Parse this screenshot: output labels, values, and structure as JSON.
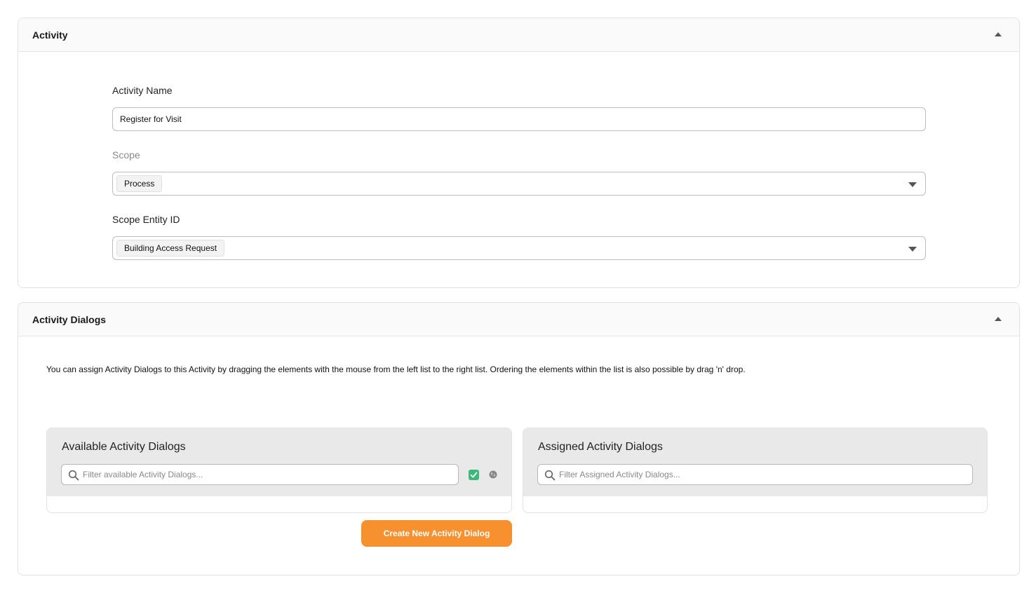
{
  "activity_section": {
    "title": "Activity",
    "fields": {
      "activity_name": {
        "label": "Activity Name",
        "value": "Register for Visit"
      },
      "scope": {
        "label": "Scope",
        "value": "Process"
      },
      "scope_entity_id": {
        "label": "Scope Entity ID",
        "value": "Building Access Request"
      }
    }
  },
  "dialogs_section": {
    "title": "Activity Dialogs",
    "info": "You can assign Activity Dialogs to this Activity by dragging the elements with the mouse from the left list to the right list. Ordering the elements within the list is also possible by drag 'n' drop.",
    "available": {
      "title": "Available Activity Dialogs",
      "placeholder": "Filter available Activity Dialogs..."
    },
    "assigned": {
      "title": "Assigned Activity Dialogs",
      "placeholder": "Filter Assigned Activity Dialogs..."
    },
    "create_button": "Create New Activity Dialog"
  },
  "colors": {
    "accent": "#f7902f",
    "check": "#3cb878"
  },
  "icons": [
    "collapse-icon",
    "caret-down-icon",
    "search-icon",
    "check-icon",
    "globe-icon"
  ]
}
